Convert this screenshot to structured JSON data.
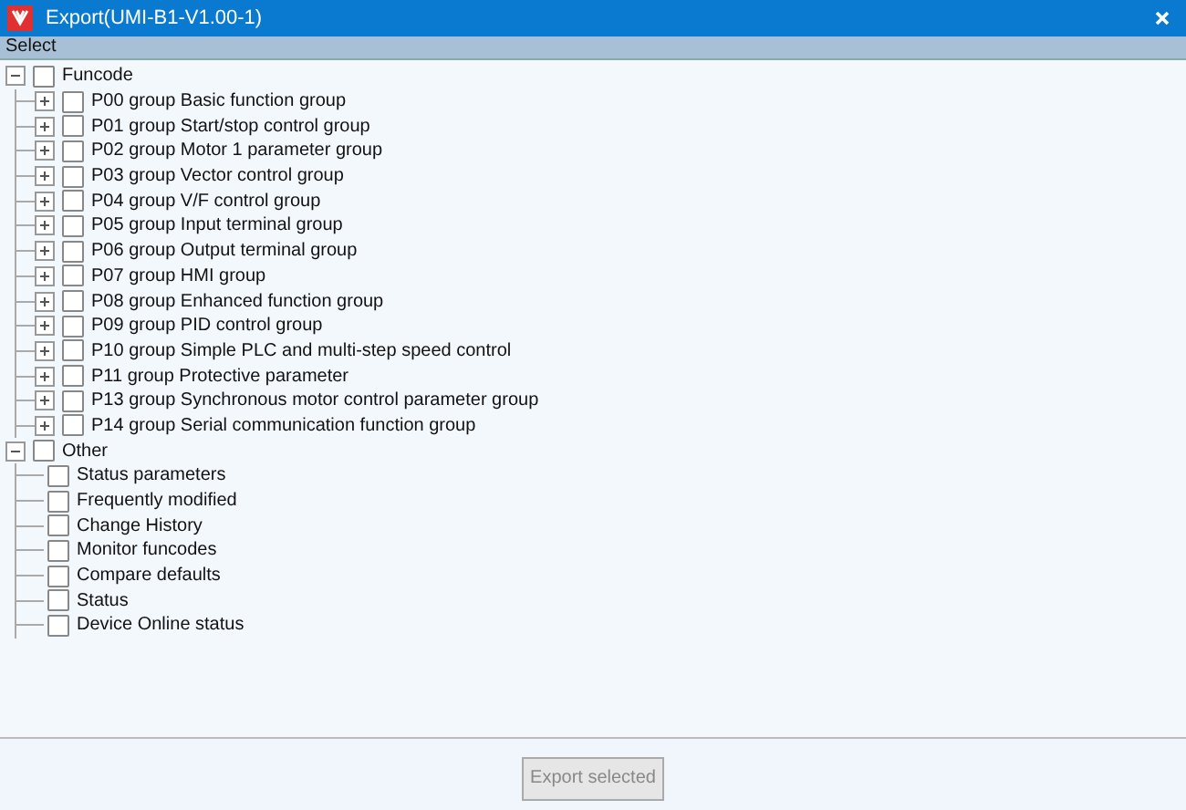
{
  "window": {
    "title": "Export(UMI-B1-V1.00-1)"
  },
  "header": "Select",
  "tree": [
    {
      "label": "Funcode",
      "kind": "group",
      "expanded": true,
      "checked": false,
      "children": [
        {
          "label": "P00 group Basic function group",
          "kind": "group",
          "expanded": false,
          "checked": false
        },
        {
          "label": "P01 group Start/stop control group",
          "kind": "group",
          "expanded": false,
          "checked": false
        },
        {
          "label": "P02 group Motor 1 parameter group",
          "kind": "group",
          "expanded": false,
          "checked": false
        },
        {
          "label": "P03 group Vector control group",
          "kind": "group",
          "expanded": false,
          "checked": false
        },
        {
          "label": "P04 group V/F control group",
          "kind": "group",
          "expanded": false,
          "checked": false
        },
        {
          "label": "P05 group Input terminal group",
          "kind": "group",
          "expanded": false,
          "checked": false
        },
        {
          "label": "P06 group Output terminal group",
          "kind": "group",
          "expanded": false,
          "checked": false
        },
        {
          "label": "P07 group HMI group",
          "kind": "group",
          "expanded": false,
          "checked": false
        },
        {
          "label": "P08 group Enhanced function group",
          "kind": "group",
          "expanded": false,
          "checked": false
        },
        {
          "label": "P09 group PID control group",
          "kind": "group",
          "expanded": false,
          "checked": false
        },
        {
          "label": "P10 group Simple PLC and multi-step speed control",
          "kind": "group",
          "expanded": false,
          "checked": false
        },
        {
          "label": "P11 group Protective parameter",
          "kind": "group",
          "expanded": false,
          "checked": false
        },
        {
          "label": "P13 group Synchronous motor control parameter group",
          "kind": "group",
          "expanded": false,
          "checked": false
        },
        {
          "label": "P14 group Serial communication function group",
          "kind": "group",
          "expanded": false,
          "checked": false
        }
      ]
    },
    {
      "label": "Other",
      "kind": "group",
      "expanded": true,
      "checked": false,
      "children": [
        {
          "label": "Status parameters",
          "kind": "leaf",
          "checked": false
        },
        {
          "label": "Frequently modified",
          "kind": "leaf",
          "checked": false
        },
        {
          "label": "Change History",
          "kind": "leaf",
          "checked": false
        },
        {
          "label": "Monitor funcodes",
          "kind": "leaf",
          "checked": false
        },
        {
          "label": "Compare defaults",
          "kind": "leaf",
          "checked": false
        },
        {
          "label": "Status",
          "kind": "leaf",
          "checked": false
        },
        {
          "label": "Device Online status",
          "kind": "leaf",
          "checked": false
        }
      ]
    }
  ],
  "export_button": {
    "label": "Export selected",
    "disabled": true
  }
}
